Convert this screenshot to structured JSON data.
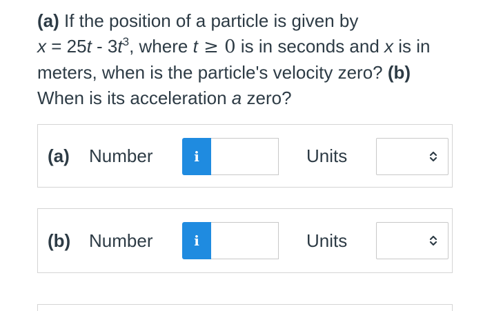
{
  "question": {
    "part_a_tag": "(a)",
    "line1_text": " If the position of a particle is given by",
    "eq_x": "x",
    "eq_mid": " = 25",
    "eq_t1": "t",
    "eq_minus": " - 3",
    "eq_t2": "t",
    "eq_exp": "3",
    "eq_where": ", where ",
    "eq_t3": "t",
    "eq_cond": " ≥ 0",
    "eq_tail": " is in seconds and ",
    "eq_x2": "x",
    "eq_tail2": " is in meters, when is the particle's velocity zero? ",
    "part_b_tag": "(b)",
    "line_b_text": " When is its acceleration ",
    "accel_symbol": "a",
    "line_b_end": " zero?"
  },
  "answers": [
    {
      "part": "(a)",
      "number_label": "Number",
      "info_icon": "i",
      "number_value": "",
      "units_label": "Units",
      "units_value": ""
    },
    {
      "part": "(b)",
      "number_label": "Number",
      "info_icon": "i",
      "number_value": "",
      "units_label": "Units",
      "units_value": ""
    }
  ],
  "colors": {
    "info_button": "#1f8be0",
    "text": "#2d3b45",
    "border": "#d4d4d4"
  }
}
